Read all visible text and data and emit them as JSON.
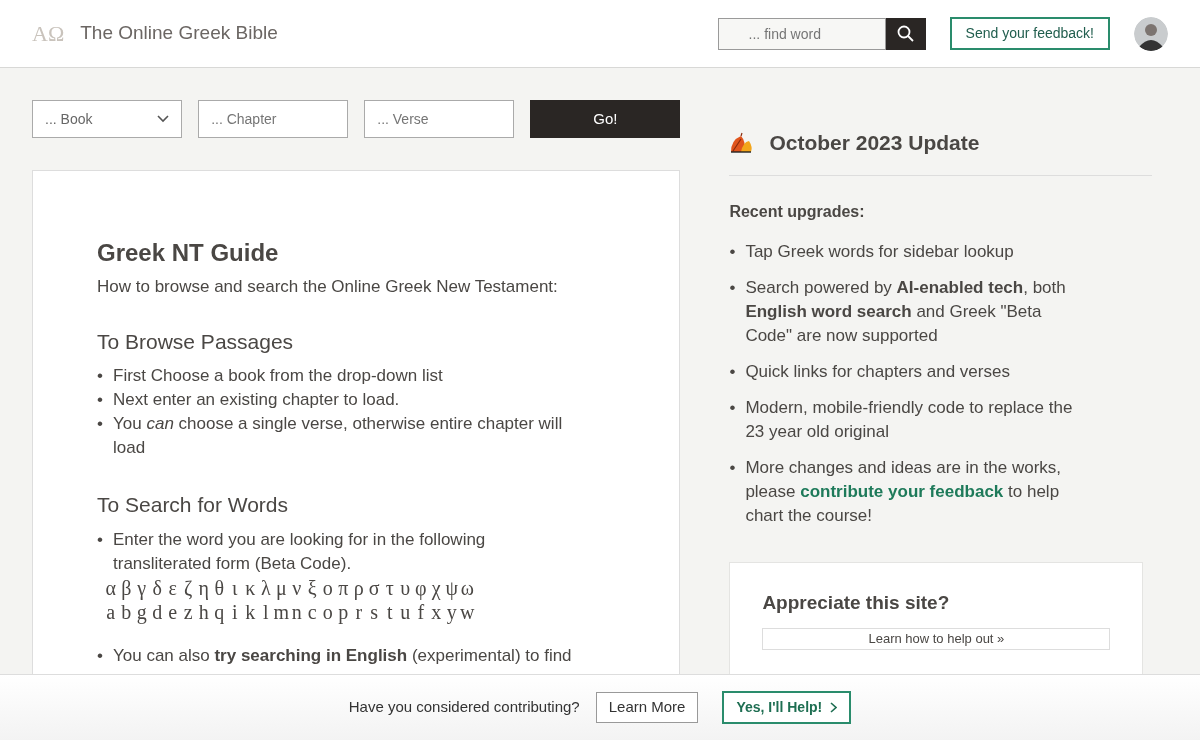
{
  "header": {
    "logo": "AΩ",
    "title": "The Online Greek Bible",
    "search": {
      "placeholder": "... find word"
    },
    "feedback_button": "Send your feedback!"
  },
  "passage_form": {
    "book": {
      "placeholder": "... Book"
    },
    "chapter": {
      "placeholder": "... Chapter"
    },
    "verse": {
      "placeholder": "... Verse"
    },
    "go_button": "Go!"
  },
  "guide": {
    "title": "Greek NT Guide",
    "intro": "How to browse and search the Online Greek New Testament:",
    "sections": [
      {
        "heading": "To Browse Passages",
        "items": [
          {
            "kind": "text",
            "marker": "•",
            "text": "First Choose a book from the drop-down list"
          },
          {
            "kind": "text",
            "marker": "•",
            "text": "Next enter an existing chapter to load."
          },
          {
            "kind": "text",
            "marker": "•",
            "text": "You *can* choose a single verse, otherwise entire chapter will load"
          }
        ]
      },
      {
        "heading": "To Search for Words",
        "items": [
          {
            "kind": "text",
            "marker": "•",
            "text": "Enter the word you are looking for in the following transliterated form (Beta Code)."
          },
          {
            "kind": "alphabet",
            "greek": [
              "α",
              "β",
              "γ",
              "δ",
              "ε",
              "ζ",
              "η",
              "θ",
              "ι",
              "κ",
              "λ",
              "μ",
              "ν",
              "ξ",
              "ο",
              "π",
              "ρ",
              "σ",
              "τ",
              "υ",
              "φ",
              "χ",
              "ψ",
              "ω"
            ],
            "beta": [
              "a",
              "b",
              "g",
              "d",
              "e",
              "z",
              "h",
              "q",
              "i",
              "k",
              "l",
              "m",
              "n",
              "c",
              "o",
              "p",
              "r",
              "s",
              "t",
              "u",
              "f",
              "x",
              "y",
              "w"
            ]
          },
          {
            "kind": "text",
            "marker": "•",
            "text": "You can also **try searching in English** (experimental) to find"
          }
        ]
      }
    ]
  },
  "update": {
    "title": "October 2023 Update",
    "subtitle": "Recent upgrades:",
    "items": [
      {
        "kind": "text",
        "marker": "•",
        "text": "Tap Greek words for sidebar lookup"
      },
      {
        "kind": "text",
        "marker": "•",
        "text": "Search powered by **AI-enabled tech**, both **English word search** and Greek \"Beta Code\" are now supported"
      },
      {
        "kind": "text",
        "marker": "•",
        "text": "Quick links for chapters and verses"
      },
      {
        "kind": "text",
        "marker": "•",
        "text": "Modern, mobile-friendly code to replace the 23 year old original"
      },
      {
        "kind": "link",
        "marker": "•",
        "before": "More changes and ideas are in the works, please ",
        "link": "contribute your feedback",
        "after": " to help chart the course!"
      }
    ]
  },
  "appreciate": {
    "title": "Appreciate this site?",
    "link": "Learn how to help out »"
  },
  "contribute_bar": {
    "question": "Have you considered contributing?",
    "learn_more": "Learn More",
    "help_button": "Yes, I'll Help!"
  }
}
